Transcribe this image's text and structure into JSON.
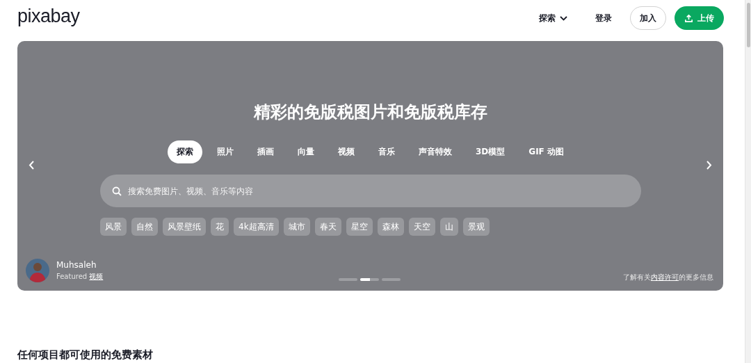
{
  "header": {
    "logo": "pixabay",
    "nav": [
      {
        "kind": "menu",
        "label": "探索"
      },
      {
        "kind": "link",
        "label": "登录"
      },
      {
        "kind": "outline",
        "label": "加入"
      },
      {
        "kind": "primary",
        "label": "上传"
      }
    ]
  },
  "hero": {
    "title": "精彩的免版税图片和免版税库存",
    "tabs": [
      {
        "label": "探索",
        "selected": true
      },
      {
        "label": "照片",
        "selected": false
      },
      {
        "label": "插画",
        "selected": false
      },
      {
        "label": "向量",
        "selected": false
      },
      {
        "label": "视频",
        "selected": false
      },
      {
        "label": "音乐",
        "selected": false
      },
      {
        "label": "声音特效",
        "selected": false
      },
      {
        "label": "3D模型",
        "selected": false
      },
      {
        "label": "GIF 动图",
        "selected": false
      }
    ],
    "search": {
      "placeholder": "搜索免费图片、视频、音乐等内容"
    },
    "tags": [
      "风景",
      "自然",
      "风景壁纸",
      "花",
      "4k超高清",
      "城市",
      "春天",
      "星空",
      "森林",
      "天空",
      "山",
      "景观"
    ],
    "author": {
      "name": "Muhsaleh",
      "caption_prefix": "Featured",
      "caption_link": "视频"
    },
    "dots": [
      {
        "selected": false
      },
      {
        "selected": true,
        "level": 0.5
      },
      {
        "selected": false
      }
    ],
    "license": {
      "before": "了解有关",
      "link": "内容许可",
      "after": "的更多信息"
    }
  },
  "section": {
    "heading": "任何项目都可使用的免费素材"
  }
}
